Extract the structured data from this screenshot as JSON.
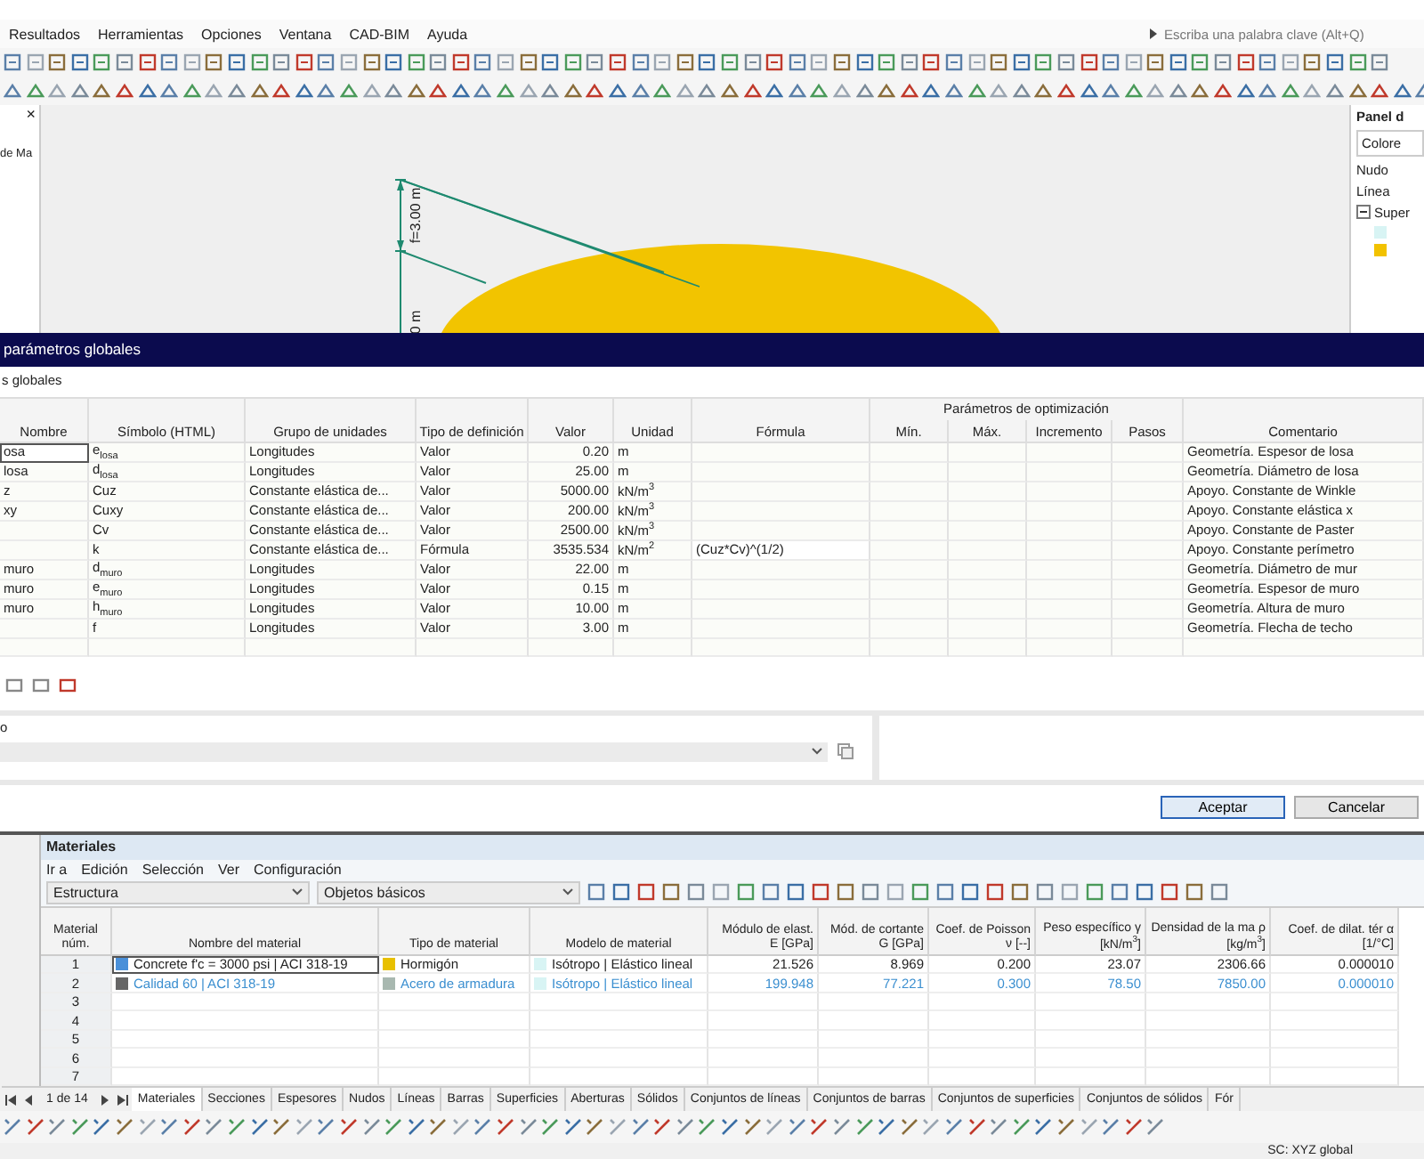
{
  "menu": [
    "Resultados",
    "Herramientas",
    "Opciones",
    "Ventana",
    "CAD-BIM",
    "Ayuda"
  ],
  "search": {
    "placeholder": "Escriba una palabra clave (Alt+Q)"
  },
  "left_panel": {
    "close": "×",
    "label": "de Ma"
  },
  "viewport": {
    "dimension_labels": [
      "f=3.00 m",
      "0 m"
    ]
  },
  "right_panel": {
    "title": "Panel d",
    "dropdown": "Colore",
    "items": [
      {
        "label": "Nudo"
      },
      {
        "label": "Línea"
      },
      {
        "label": "Super",
        "expanded": true,
        "children": [
          {
            "color": "#d8f4f4"
          },
          {
            "color": "#f2c200"
          }
        ]
      }
    ]
  },
  "dialog": {
    "title": "parámetros globales",
    "subtitle": "s globales",
    "table": {
      "columns": [
        {
          "label": "Nombre",
          "kind": "text"
        },
        {
          "label": "Símbolo (HTML)",
          "kind": "text"
        },
        {
          "label": "Grupo de unidades",
          "kind": "text"
        },
        {
          "label": "Tipo de definición",
          "kind": "text"
        },
        {
          "label": "Valor",
          "kind": "number"
        },
        {
          "label": "Unidad",
          "kind": "text"
        },
        {
          "label": "Fórmula",
          "kind": "text"
        },
        {
          "group": "Parámetros de optimización",
          "columns": [
            {
              "label": "Mín."
            },
            {
              "label": "Máx."
            },
            {
              "label": "Incremento"
            },
            {
              "label": "Pasos"
            }
          ]
        },
        {
          "label": "Comentario",
          "kind": "text"
        }
      ],
      "rows": [
        {
          "selected": true,
          "cells": [
            "osa",
            "e$_{losa}$",
            "Longitudes",
            "Valor",
            "0.20",
            "m",
            null,
            null,
            null,
            null,
            null,
            "Geometría. Espesor de losa"
          ]
        },
        {
          "selected": false,
          "cells": [
            "losa",
            "d$_{losa}$",
            "Longitudes",
            "Valor",
            "25.00",
            "m",
            null,
            null,
            null,
            null,
            null,
            "Geometría. Diámetro de losa"
          ]
        },
        {
          "selected": false,
          "cells": [
            "z",
            "Cuz",
            "Constante elástica de...",
            "Valor",
            "5000.00",
            "kN/m$^{3}$",
            null,
            null,
            null,
            null,
            null,
            "Apoyo. Constante de Winkle"
          ]
        },
        {
          "selected": false,
          "cells": [
            "xy",
            "Cuxy",
            "Constante elástica de...",
            "Valor",
            "200.00",
            "kN/m$^{3}$",
            null,
            null,
            null,
            null,
            null,
            "Apoyo. Constante elástica x"
          ]
        },
        {
          "selected": false,
          "cells": [
            null,
            "Cv",
            "Constante elástica de...",
            "Valor",
            "2500.00",
            "kN/m$^{3}$",
            null,
            null,
            null,
            null,
            null,
            "Apoyo. Constante de Paster"
          ]
        },
        {
          "selected": false,
          "cells": [
            null,
            "k",
            "Constante elástica de...",
            "Fórmula",
            "3535.534",
            "kN/m$^{2}$",
            "(Cuz*Cv)^(1/2)",
            null,
            null,
            null,
            null,
            "Apoyo. Constante perímetro"
          ]
        },
        {
          "selected": false,
          "cells": [
            "muro",
            "d$_{muro}$",
            "Longitudes",
            "Valor",
            "22.00",
            "m",
            null,
            null,
            null,
            null,
            null,
            "Geometría. Diámetro de mur"
          ]
        },
        {
          "selected": false,
          "cells": [
            "muro",
            "e$_{muro}$",
            "Longitudes",
            "Valor",
            "0.15",
            "m",
            null,
            null,
            null,
            null,
            null,
            "Geometría. Espesor de muro"
          ]
        },
        {
          "selected": false,
          "cells": [
            "muro",
            "h$_{muro}$",
            "Longitudes",
            "Valor",
            "10.00",
            "m",
            null,
            null,
            null,
            null,
            null,
            "Geometría. Altura de muro"
          ]
        },
        {
          "selected": false,
          "cells": [
            null,
            "f",
            "Longitudes",
            "Valor",
            "3.00",
            "m",
            null,
            null,
            null,
            null,
            null,
            "Geometría. Flecha de techo"
          ]
        }
      ]
    },
    "field_label": "o",
    "buttons": [
      {
        "label": "Aceptar",
        "default": true
      },
      {
        "label": "Cancelar",
        "default": false
      }
    ]
  },
  "materials": {
    "title": "Materiales",
    "menu": [
      "Ir a",
      "Edición",
      "Selección",
      "Ver",
      "Configuración"
    ],
    "dropdowns": [
      "Estructura",
      "Objetos básicos"
    ],
    "columns": [
      "Material núm.",
      "Nombre del material",
      "Tipo de material",
      "Modelo de material",
      "Módulo de elast. E [GPa]",
      "Mód. de cortante G [GPa]",
      "Coef. de Poisson ν [--]",
      "Peso específico γ [kN/m$^{3}$]",
      "Densidad de la ma ρ [kg/m$^{3}$]",
      "Coef. de dilat. tér α [1/°C]"
    ],
    "rows": [
      {
        "num": "1",
        "selected": true,
        "highlighted": false,
        "name": {
          "label": "Concrete f'c = 3000 psi | ACI 318-19",
          "color": "#4a90d9"
        },
        "type": {
          "label": "Hormigón",
          "color": "#e8c000"
        },
        "model": {
          "label": "Isótropo | Elástico lineal",
          "color": "#d8f4f4"
        },
        "values": [
          "21.526",
          "8.969",
          "0.200",
          "23.07",
          "2306.66",
          "0.000010"
        ]
      },
      {
        "num": "2",
        "selected": false,
        "highlighted": true,
        "name": {
          "label": "Calidad 60 | ACI 318-19",
          "color": "#666666"
        },
        "type": {
          "label": "Acero de armadura",
          "color": "#a8b8b0"
        },
        "model": {
          "label": "Isótropo | Elástico lineal",
          "color": "#d8f4f4"
        },
        "values": [
          "199.948",
          "77.221",
          "0.300",
          "78.50",
          "7850.00",
          "0.000010"
        ]
      },
      {
        "num": "3"
      },
      {
        "num": "4"
      },
      {
        "num": "5"
      },
      {
        "num": "6"
      },
      {
        "num": "7"
      }
    ],
    "pager": "1 de 14",
    "tabs": [
      {
        "label": "Materiales",
        "selected": true
      },
      {
        "label": "Secciones",
        "selected": false
      },
      {
        "label": "Espesores",
        "selected": false
      },
      {
        "label": "Nudos",
        "selected": false
      },
      {
        "label": "Líneas",
        "selected": false
      },
      {
        "label": "Barras",
        "selected": false
      },
      {
        "label": "Superficies",
        "selected": false
      },
      {
        "label": "Aberturas",
        "selected": false
      },
      {
        "label": "Sólidos",
        "selected": false
      },
      {
        "label": "Conjuntos de líneas",
        "selected": false
      },
      {
        "label": "Conjuntos de barras",
        "selected": false
      },
      {
        "label": "Conjuntos de superficies",
        "selected": false
      },
      {
        "label": "Conjuntos de sólidos",
        "selected": false
      },
      {
        "label": "Fór",
        "selected": false
      }
    ]
  },
  "status_bar": "SC: XYZ global"
}
